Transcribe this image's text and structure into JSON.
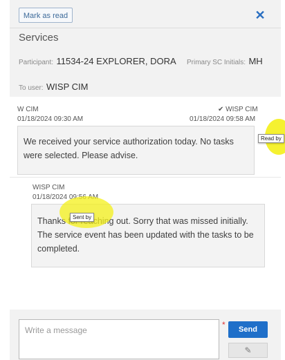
{
  "header": {
    "mark_read_label": "Mark as read",
    "close_icon": "close-icon"
  },
  "section_title": "Services",
  "participant": {
    "label": "Participant:",
    "value": "11534-24 EXPLORER, DORA",
    "sc_label": "Primary SC Initials:",
    "sc_value": "MH"
  },
  "to_user": {
    "label": "To user:",
    "value": "WISP CIM"
  },
  "messages": [
    {
      "sender": "W CIM",
      "timestamp": "01/18/2024 09:30 AM",
      "read_by": "✔ WISP CIM",
      "read_timestamp": "01/18/2024 09:58 AM",
      "body": "We received your service authorization today. No tasks were selected. Please advise."
    },
    {
      "sender": "WISP CIM",
      "timestamp": "01/18/2024 09:56 AM",
      "body": "Thanks for reaching out. Sorry that was missed initially. The service event has been updated with the tasks to be completed."
    }
  ],
  "tooltips": {
    "read_by": "Read by",
    "sent_by": "Sent by"
  },
  "composer": {
    "placeholder": "Write a message",
    "required_mark": "*",
    "send_label": "Send",
    "attach_icon": "paperclip-icon"
  },
  "colors": {
    "accent": "#1f6fc1",
    "highlight": "#f4f01a"
  }
}
